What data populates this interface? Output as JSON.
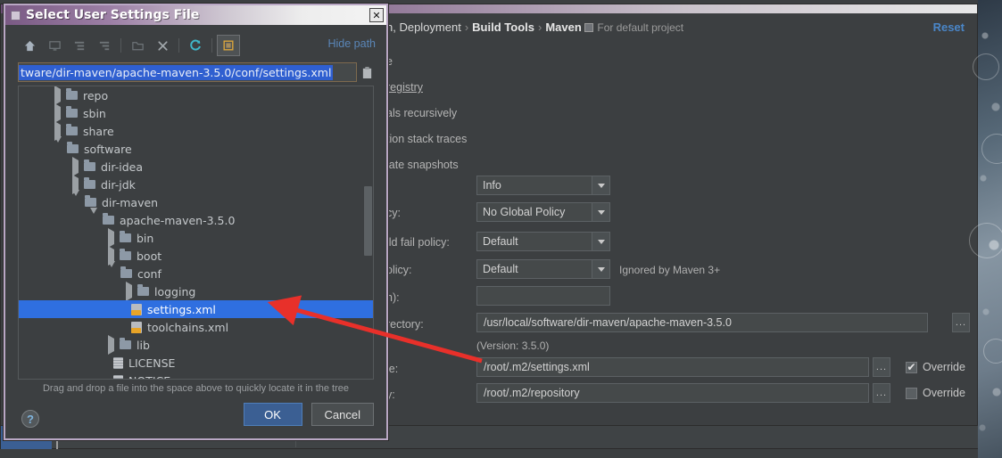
{
  "ide": {
    "breadcrumb": {
      "prefix": "n, Deployment",
      "sep": "›",
      "crumb2": "Build Tools",
      "crumb3": "Maven",
      "scope": "For default project"
    },
    "reset_label": "Reset",
    "hidden_labels": [
      "e",
      "registry",
      "als recursively",
      "tion stack traces",
      "late snapshots"
    ],
    "fields": {
      "output_level_value": "Info",
      "checksum_policy_label": "cy:",
      "checksum_policy_value": "No Global Policy",
      "multiproject_label": "ild fail policy:",
      "multiproject_value": "Default",
      "plugin_policy_label": "olicy:",
      "plugin_policy_value": "Default",
      "plugin_policy_note": "Ignored by Maven 3+",
      "threads_label": "n):",
      "threads_value": "",
      "home_label": "rectory:",
      "home_value": "/usr/local/software/dir-maven/apache-maven-3.5.0",
      "version_note": "(Version: 3.5.0)",
      "settings_label": "le:",
      "settings_value": "/root/.m2/settings.xml",
      "repo_label": "y:",
      "repo_value": "/root/.m2/repository",
      "override_label": "Override",
      "override_settings_checked": true,
      "override_repo_checked": false,
      "browse_label": "..."
    }
  },
  "dialog": {
    "title": "Select User Settings File",
    "close_label": "✕",
    "hide_path_label": "Hide path",
    "path_value": "tware/dir-maven/apache-maven-3.5.0/conf/settings.xml",
    "toolbar": [
      {
        "name": "home-icon",
        "glyph": "⌂"
      },
      {
        "name": "desktop-icon",
        "glyph": "▭"
      },
      {
        "name": "expand-all-icon",
        "glyph": "▤"
      },
      {
        "name": "collapse-all-icon",
        "glyph": "▥"
      },
      {
        "name": "new-folder-icon",
        "glyph": "🗀"
      },
      {
        "name": "delete-icon",
        "glyph": "✕"
      },
      {
        "name": "refresh-icon",
        "glyph": "↻"
      },
      {
        "name": "show-hidden-files-icon",
        "glyph": "▩"
      }
    ],
    "tree": [
      {
        "label": "repo",
        "depth": 1,
        "state": "collapsed",
        "icon": "folder",
        "selected": false
      },
      {
        "label": "sbin",
        "depth": 1,
        "state": "collapsed",
        "icon": "folder",
        "selected": false
      },
      {
        "label": "share",
        "depth": 1,
        "state": "collapsed",
        "icon": "folder",
        "selected": false
      },
      {
        "label": "software",
        "depth": 1,
        "state": "expanded",
        "icon": "folder",
        "selected": false
      },
      {
        "label": "dir-idea",
        "depth": 2,
        "state": "collapsed",
        "icon": "folder",
        "selected": false
      },
      {
        "label": "dir-jdk",
        "depth": 2,
        "state": "collapsed",
        "icon": "folder",
        "selected": false
      },
      {
        "label": "dir-maven",
        "depth": 2,
        "state": "expanded",
        "icon": "folder",
        "selected": false
      },
      {
        "label": "apache-maven-3.5.0",
        "depth": 3,
        "state": "expanded",
        "icon": "folder",
        "selected": false
      },
      {
        "label": "bin",
        "depth": 4,
        "state": "collapsed",
        "icon": "folder",
        "selected": false
      },
      {
        "label": "boot",
        "depth": 4,
        "state": "collapsed",
        "icon": "folder",
        "selected": false
      },
      {
        "label": "conf",
        "depth": 4,
        "state": "expanded",
        "icon": "folder",
        "selected": false
      },
      {
        "label": "logging",
        "depth": 5,
        "state": "collapsed",
        "icon": "folder",
        "selected": false
      },
      {
        "label": "settings.xml",
        "depth": 5,
        "state": "leaf",
        "icon": "xml",
        "selected": true
      },
      {
        "label": "toolchains.xml",
        "depth": 5,
        "state": "leaf",
        "icon": "xml",
        "selected": false
      },
      {
        "label": "lib",
        "depth": 4,
        "state": "collapsed",
        "icon": "folder",
        "selected": false
      },
      {
        "label": "LICENSE",
        "depth": 4,
        "state": "leaf",
        "icon": "doc",
        "selected": false
      },
      {
        "label": "NOTICE",
        "depth": 4,
        "state": "leaf",
        "icon": "doc",
        "selected": false
      }
    ],
    "dnd_hint": "Drag and drop a file into the space above to quickly locate it in the tree",
    "help_label": "?",
    "ok_label": "OK",
    "cancel_label": "Cancel"
  },
  "colors": {
    "selection_blue": "#2f6fe0",
    "link_blue": "#4a86c8",
    "annotation_red": "#e8302a",
    "dialog_border": "#b9a7c4"
  }
}
